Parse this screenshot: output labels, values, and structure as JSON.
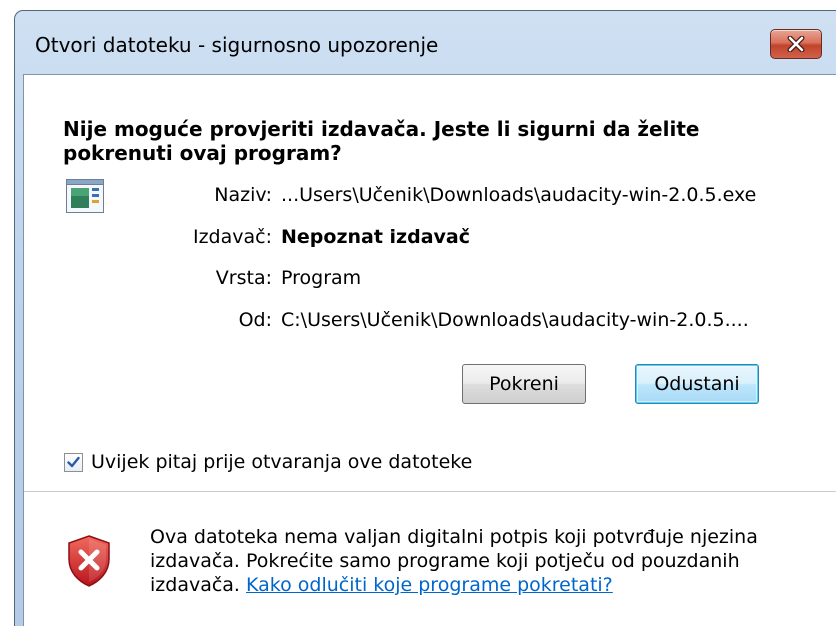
{
  "window": {
    "title": "Otvori datoteku - sigurnosno upozorenje"
  },
  "heading": "Nije moguće provjeriti izdavača. Jeste li sigurni da želite pokrenuti ovaj program?",
  "info": {
    "name_label": "Naziv:",
    "name_value": "...Users\\Učenik\\Downloads\\audacity-win-2.0.5.exe",
    "publisher_label": "Izdavač:",
    "publisher_value": "Nepoznat izdavač",
    "type_label": "Vrsta:",
    "type_value": "Program",
    "from_label": "Od:",
    "from_value": "C:\\Users\\Učenik\\Downloads\\audacity-win-2.0.5...."
  },
  "buttons": {
    "run_label": "Pokreni",
    "cancel_label": "Odustani"
  },
  "checkbox": {
    "label": "Uvijek pitaj prije otvaranja ove datoteke",
    "checked": true
  },
  "footer": {
    "text": "Ova datoteka nema valjan digitalni potpis koji potvrđuje njezina izdavača. Pokrećite samo programe koji potječu od pouzdanih izdavača.",
    "link_text": "Kako odlučiti koje programe pokretati?"
  },
  "icons": {
    "close": "close-icon",
    "application": "application-icon",
    "checkmark": "checkmark-icon",
    "shield": "security-shield-error-icon"
  },
  "colors": {
    "link": "#0066cc",
    "close_button": "#c2432c",
    "shield_red": "#d3262b"
  }
}
